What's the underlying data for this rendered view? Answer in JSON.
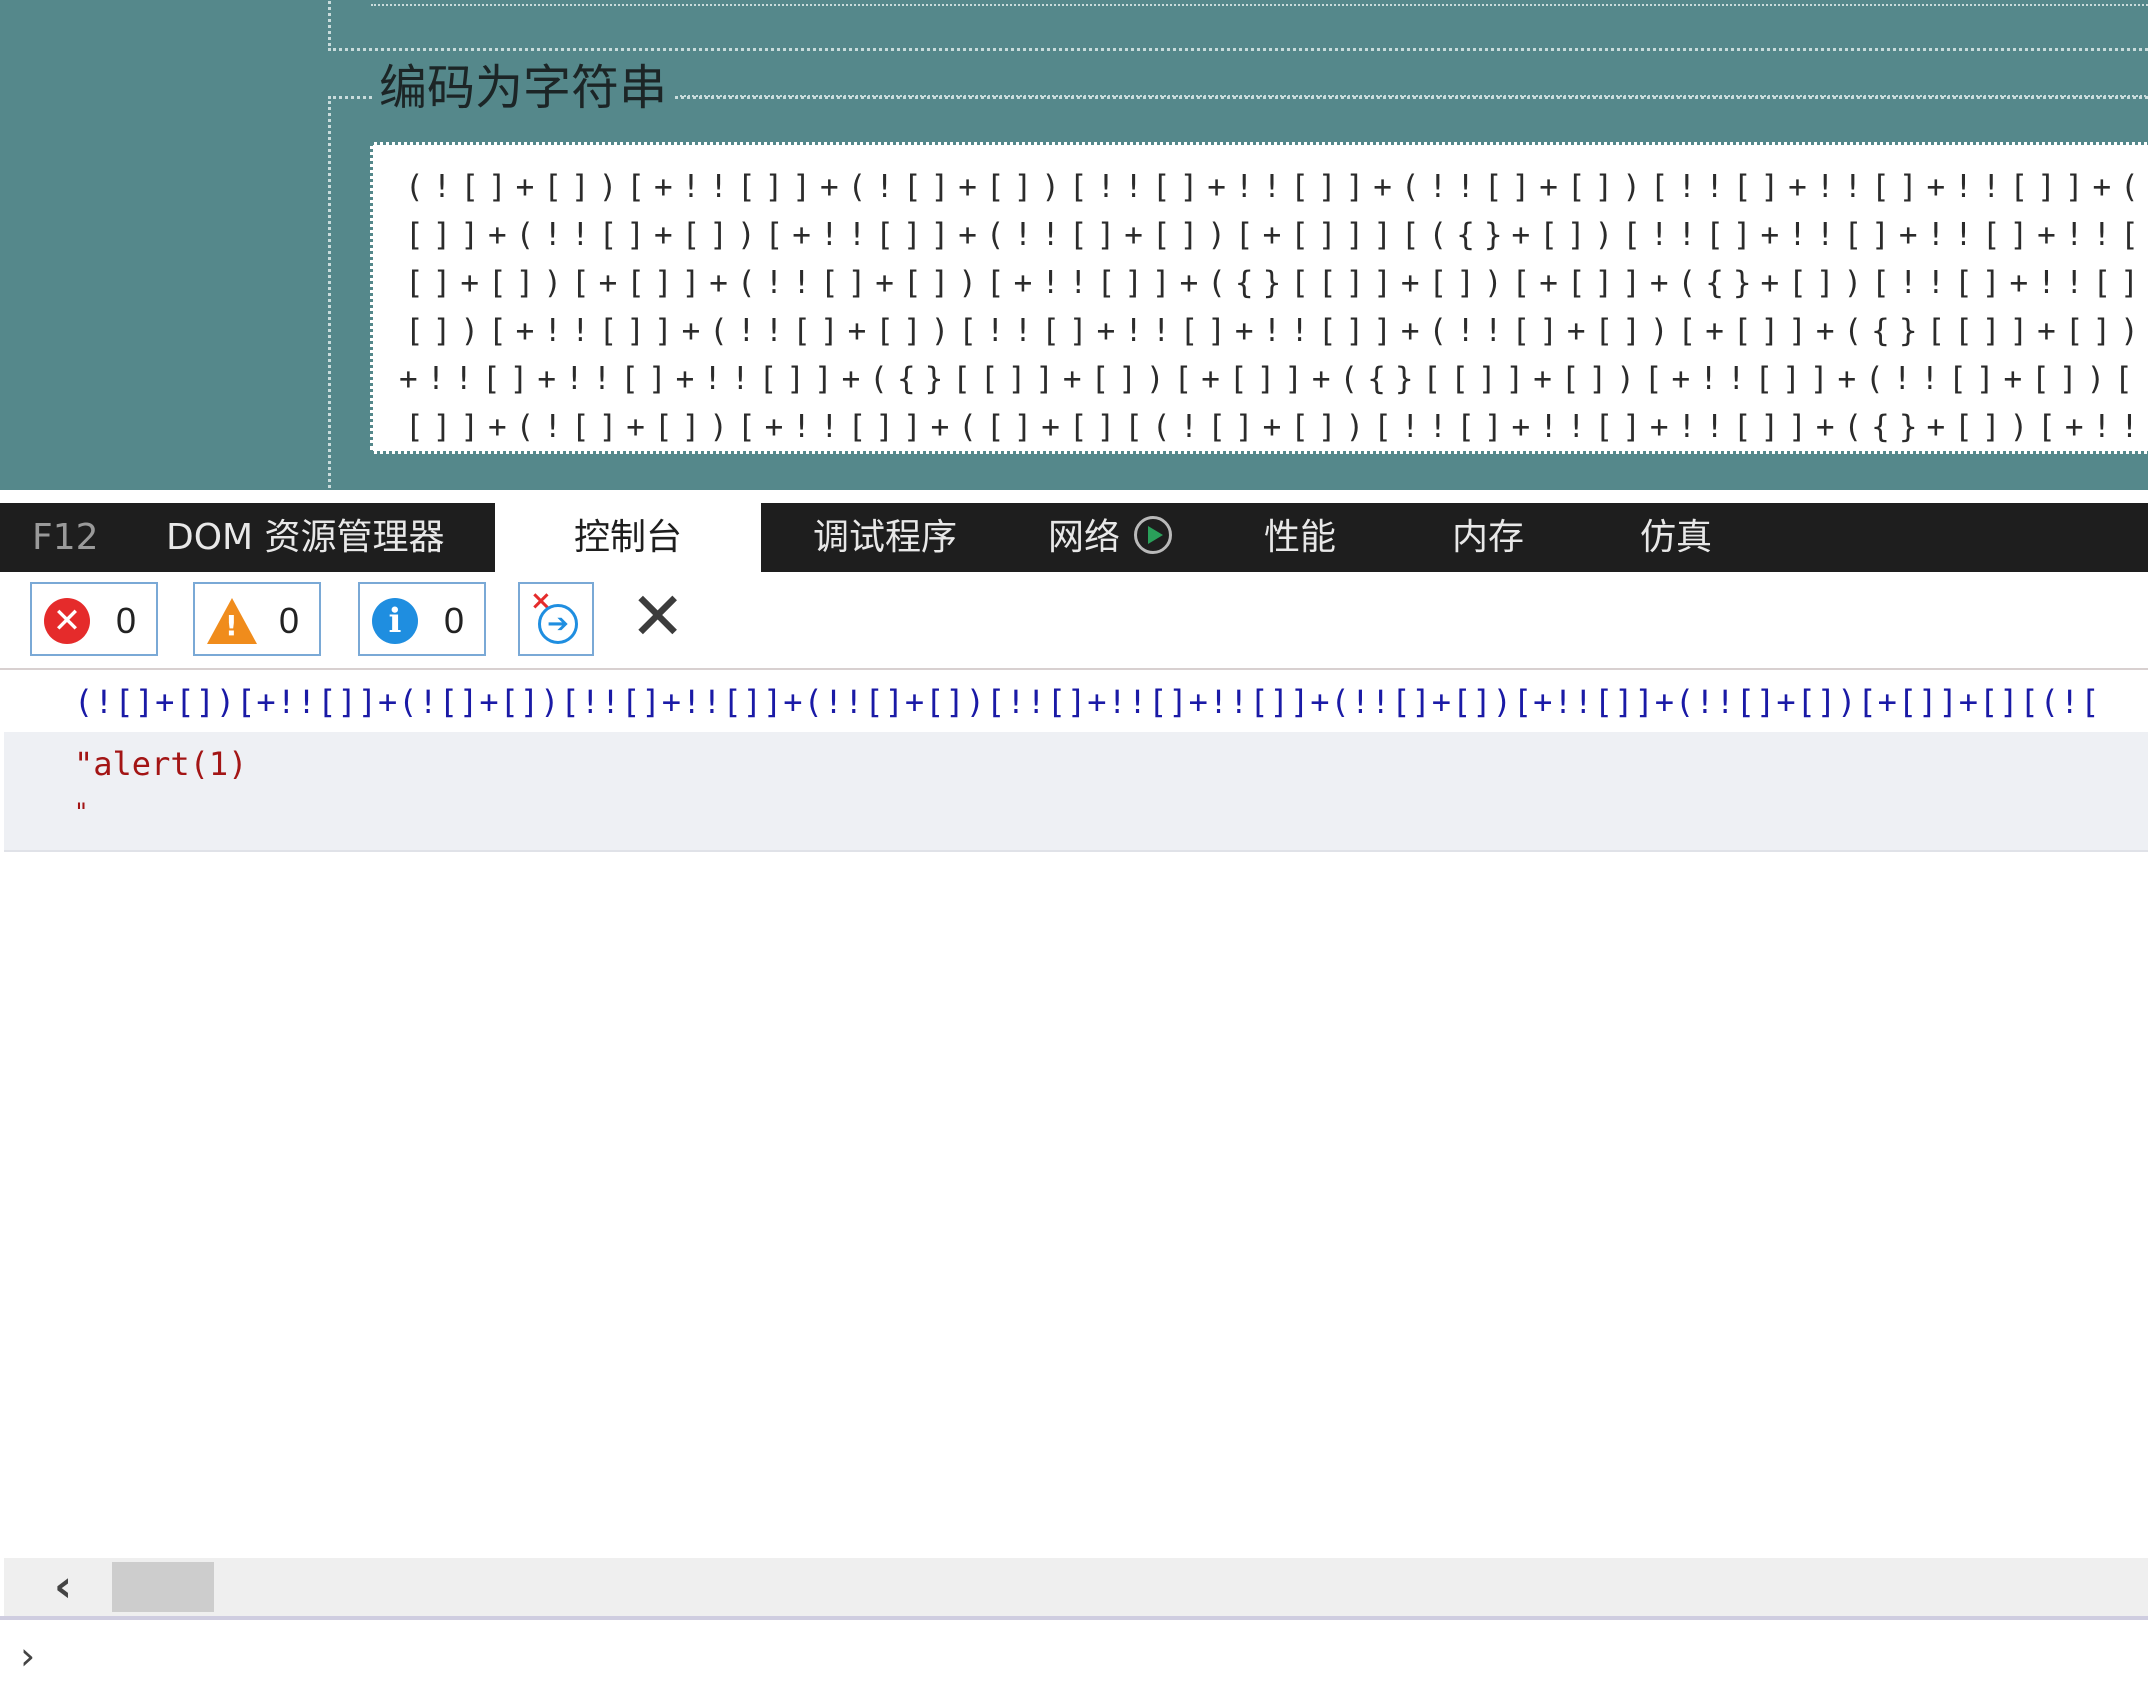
{
  "page": {
    "legend": "编码为字符串",
    "encoded_lines": [
      "(![]+[])[+!![]]+(![]+[])[!![]+!![]]+(!![]+[])[!![]+!![]+!![]]+(!![]+[",
      "[]]+(!![]+[])[+!![]]+(!![]+[])[+[]]][({}+[])[!![]+!![]+!![]+!![]+!![]",
      "[]+[])[+[]]+(!![]+[])[+!![]]+({}[[]]+[])[+[]]+({}+[])[!![]+!![]+!![]+!",
      "[])[+!![]]+(!![]+[])[!![]+!![]+!![]]+(!![]+[])[+[]]+({}[[]]+[])[+[]]+(",
      "+!![]+!![]+!![]]+({}[[]]+[])[+[]]+({}[[]]+[])[+!![]]+(!![]+[])[!![]+!!",
      "[]]+(![]+[])[+!![]]+([]+[][(![]+[])[!![]+!![]+!![]]+({}+[])[+!![]]+(!!"
    ]
  },
  "devtools": {
    "tabs": {
      "f12": "F12",
      "dom": "DOM 资源管理器",
      "console": "控制台",
      "debugger": "调试程序",
      "network": "网络",
      "performance": "性能",
      "memory": "内存",
      "emulation": "仿真"
    },
    "toolbar": {
      "errors_count": "0",
      "warnings_count": "0",
      "info_count": "0",
      "error_icon_glyph": "✕",
      "warning_icon_glyph": "!",
      "info_icon_glyph": "i",
      "clear_glyph": "✕"
    },
    "console": {
      "input_echo": "(![]+[])[+!![]]+(![]+[])[!![]+!![]]+(!![]+[])[!![]+!![]+!![]]+(!![]+[])[+!![]]+(!![]+[])[+[]]+[][(![",
      "result_line1": "\"alert(1)",
      "result_line2": "\""
    },
    "scrollbar": {
      "left_arrow": "‹"
    },
    "prompt": "›"
  },
  "colors": {
    "page_bg": "#55888b",
    "tabbar_bg": "#1e1e1e",
    "echo_text": "#1a1aa6",
    "string_result": "#a31515",
    "error": "#e52b2b",
    "warning": "#f08c1c",
    "info": "#1f8ee0"
  }
}
